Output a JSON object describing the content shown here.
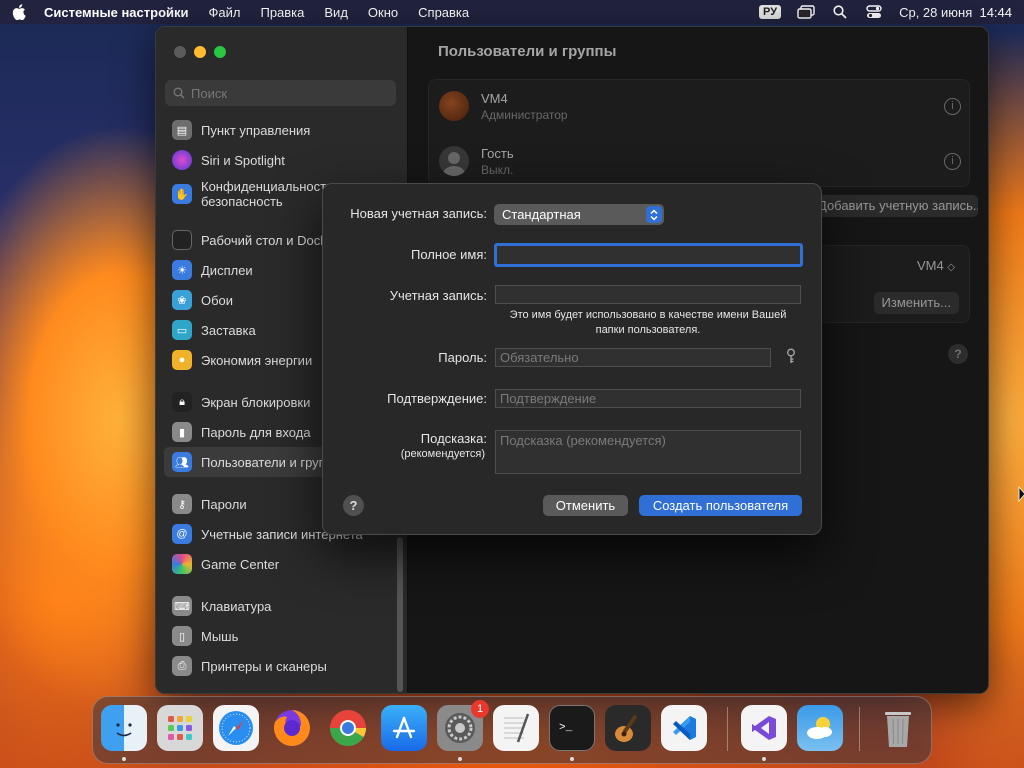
{
  "menubar": {
    "app_name": "Системные настройки",
    "items": [
      "Файл",
      "Правка",
      "Вид",
      "Окно",
      "Справка"
    ],
    "input_source": "РУ",
    "datetime": "Ср, 28 июня  14:44"
  },
  "sidebar": {
    "search_placeholder": "Поиск",
    "items": [
      {
        "label": "Пункт управления",
        "icon": "control-center-icon",
        "color": "#6d6d6d"
      },
      {
        "label": "Siri и Spotlight",
        "icon": "siri-icon",
        "color": "#b0369e"
      },
      {
        "label": "Конфиденциальность и безопасность",
        "icon": "privacy-hand-icon",
        "color": "#3a7be0"
      },
      {
        "label": "Рабочий стол и Dock",
        "icon": "desktop-dock-icon",
        "color": "#2a2a2a"
      },
      {
        "label": "Дисплеи",
        "icon": "displays-icon",
        "color": "#3a7be0"
      },
      {
        "label": "Обои",
        "icon": "wallpaper-icon",
        "color": "#3aa0d8"
      },
      {
        "label": "Заставка",
        "icon": "screensaver-icon",
        "color": "#2fa5c8"
      },
      {
        "label": "Экономия энергии",
        "icon": "energy-icon",
        "color": "#f0b22a"
      },
      {
        "label": "Экран блокировки",
        "icon": "lock-screen-icon",
        "color": "#2a2a2a"
      },
      {
        "label": "Пароль для входа",
        "icon": "login-password-icon",
        "color": "#8a8a8a"
      },
      {
        "label": "Пользователи и группы",
        "icon": "users-groups-icon",
        "color": "#3a7be0"
      },
      {
        "label": "Пароли",
        "icon": "passwords-key-icon",
        "color": "#8a8a8a"
      },
      {
        "label": "Учетные записи интернета",
        "icon": "internet-accounts-icon",
        "color": "#3a7be0"
      },
      {
        "label": "Game Center",
        "icon": "game-center-icon",
        "color": "#e04a8a"
      },
      {
        "label": "Клавиатура",
        "icon": "keyboard-icon",
        "color": "#8a8a8a"
      },
      {
        "label": "Мышь",
        "icon": "mouse-icon",
        "color": "#8a8a8a"
      },
      {
        "label": "Принтеры и сканеры",
        "icon": "printers-icon",
        "color": "#8a8a8a"
      }
    ]
  },
  "main": {
    "title": "Пользователи и группы",
    "users": [
      {
        "name": "VM4",
        "role": "Администратор"
      },
      {
        "name": "Гость",
        "role": "Выкл."
      }
    ],
    "add_account_label": "Добавить учетную запись...",
    "auto_login_user": "VM4",
    "change_label": "Изменить..."
  },
  "dialog": {
    "new_account_label": "Новая учетная запись:",
    "account_type": "Стандартная",
    "full_name_label": "Полное имя:",
    "full_name_value": "",
    "account_name_label": "Учетная запись:",
    "account_name_value": "",
    "account_hint": "Это имя будет использовано в качестве имени Вашей папки пользователя.",
    "password_label": "Пароль:",
    "password_placeholder": "Обязательно",
    "verify_label": "Подтверждение:",
    "verify_placeholder": "Подтверждение",
    "hint_label": "Подсказка:",
    "hint_label_sub": "(рекомендуется)",
    "hint_placeholder": "Подсказка (рекомендуется)",
    "cancel_label": "Отменить",
    "create_label": "Создать пользователя",
    "help_glyph": "?"
  },
  "dock": {
    "apps": [
      {
        "name": "Finder",
        "icon": "finder-icon"
      },
      {
        "name": "Launchpad",
        "icon": "launchpad-icon"
      },
      {
        "name": "Safari",
        "icon": "safari-icon"
      },
      {
        "name": "Firefox",
        "icon": "firefox-icon"
      },
      {
        "name": "Chrome",
        "icon": "chrome-icon"
      },
      {
        "name": "App Store",
        "icon": "app-store-icon"
      },
      {
        "name": "Системные настройки",
        "icon": "system-settings-icon",
        "badge": "1"
      },
      {
        "name": "TextEdit",
        "icon": "textedit-icon"
      },
      {
        "name": "Terminal",
        "icon": "terminal-icon"
      },
      {
        "name": "GarageBand",
        "icon": "garageband-icon"
      },
      {
        "name": "Visual Studio Code",
        "icon": "vscode-icon"
      },
      {
        "name": "Visual Studio",
        "icon": "visual-studio-icon"
      },
      {
        "name": "Weather",
        "icon": "weather-icon"
      },
      {
        "name": "Trash",
        "icon": "trash-icon"
      }
    ]
  },
  "colors": {
    "accent": "#2f6fd6",
    "traffic_min": "#febc2e",
    "traffic_max": "#28c840",
    "badge": "#e8372b"
  }
}
